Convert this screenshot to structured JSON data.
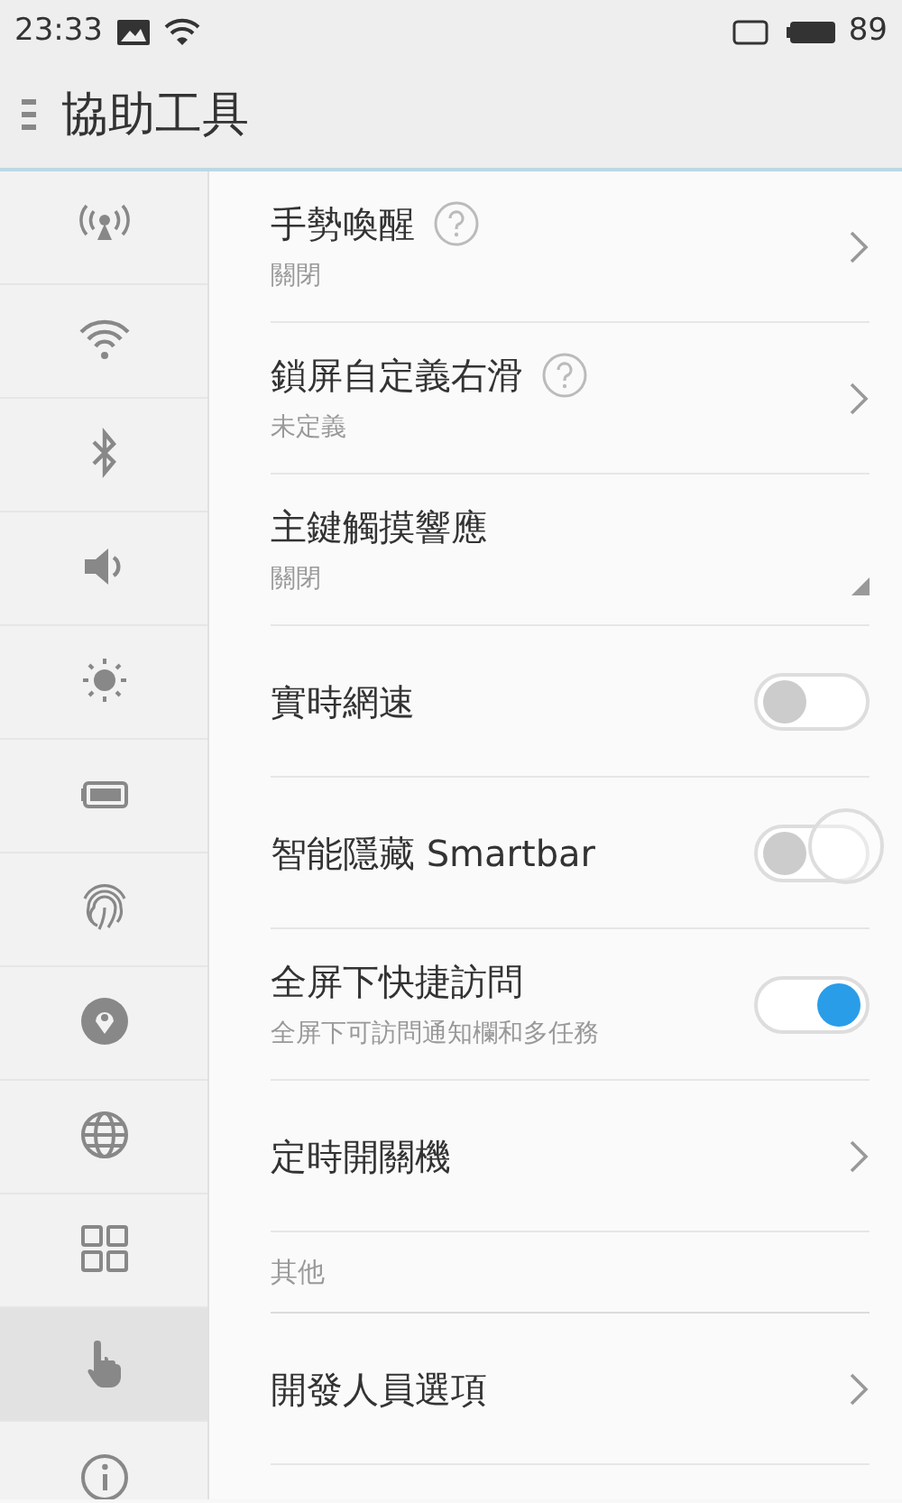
{
  "status_bar": {
    "time": "23:33",
    "battery": "89"
  },
  "title_bar": {
    "title": "協助工具"
  },
  "sidebar": {
    "items": [
      {
        "selected": false
      },
      {
        "selected": false
      },
      {
        "selected": false
      },
      {
        "selected": false
      },
      {
        "selected": false
      },
      {
        "selected": false
      },
      {
        "selected": false
      },
      {
        "selected": false
      },
      {
        "selected": false
      },
      {
        "selected": false
      },
      {
        "selected": true
      },
      {
        "selected": false
      }
    ]
  },
  "settings": [
    {
      "kind": "link",
      "title": "手勢喚醒",
      "help": true,
      "subtitle": "關閉"
    },
    {
      "kind": "link",
      "title": "鎖屏自定義右滑",
      "help": true,
      "subtitle": "未定義"
    },
    {
      "kind": "dropdown",
      "title": "主鍵觸摸響應",
      "subtitle": "關閉"
    },
    {
      "kind": "toggle",
      "title": "實時網速",
      "on": false
    },
    {
      "kind": "toggle",
      "title": "智能隱藏 Smartbar",
      "on": false
    },
    {
      "kind": "toggle",
      "title": "全屏下快捷訪問",
      "subtitle": "全屏下可訪問通知欄和多任務",
      "on": true
    },
    {
      "kind": "link",
      "title": "定時開關機"
    },
    {
      "kind": "header",
      "title": "其他"
    },
    {
      "kind": "link",
      "title": "開發人員選項"
    }
  ]
}
